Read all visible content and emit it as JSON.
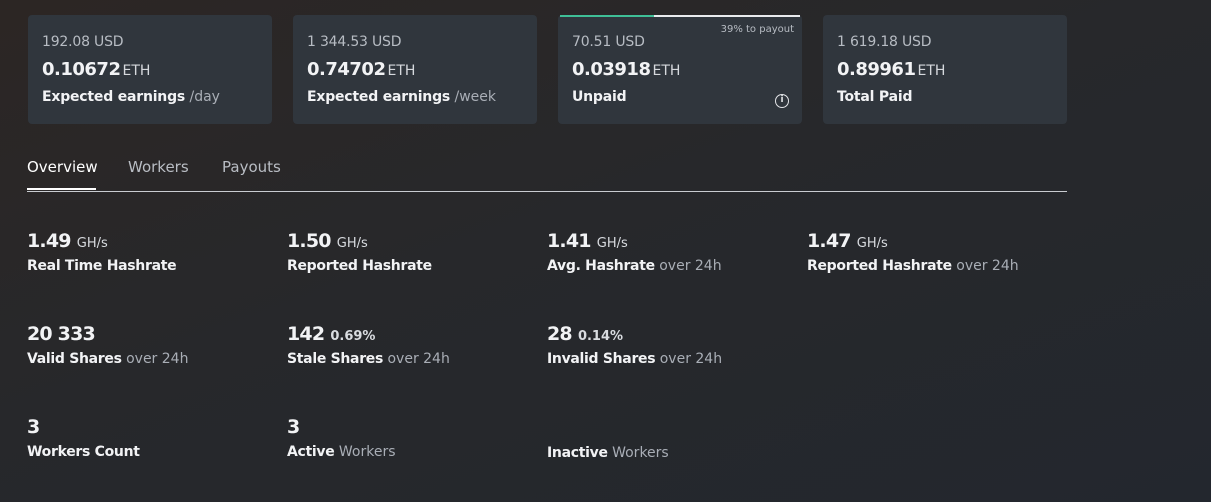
{
  "cards": [
    {
      "usd": "192.08 USD",
      "eth": "0.10672",
      "unit": "ETH",
      "label": "Expected earnings",
      "sub": "/day"
    },
    {
      "usd": "1 344.53 USD",
      "eth": "0.74702",
      "unit": "ETH",
      "label": "Expected earnings",
      "sub": "/week"
    },
    {
      "usd": "70.51 USD",
      "eth": "0.03918",
      "unit": "ETH",
      "label": "Unpaid",
      "payout_note": "39% to payout",
      "payout_progress": 0.39
    },
    {
      "usd": "1 619.18 USD",
      "eth": "0.89961",
      "unit": "ETH",
      "label": "Total Paid"
    }
  ],
  "tabs": [
    {
      "label": "Overview",
      "active": true
    },
    {
      "label": "Workers"
    },
    {
      "label": "Payouts"
    }
  ],
  "stats": {
    "realtime": {
      "value": "1.49",
      "unit": "GH/s",
      "label": "Real Time Hashrate"
    },
    "reported": {
      "value": "1.50",
      "unit": "GH/s",
      "label": "Reported Hashrate"
    },
    "avg": {
      "value": "1.41",
      "unit": "GH/s",
      "label": "Avg. Hashrate",
      "sub": "over 24h"
    },
    "reported24": {
      "value": "1.47",
      "unit": "GH/s",
      "label": "Reported Hashrate",
      "sub": "over 24h"
    },
    "valid": {
      "value": "20 333",
      "label": "Valid Shares",
      "sub": "over 24h"
    },
    "stale": {
      "value": "142",
      "pct": "0.69%",
      "label": "Stale Shares",
      "sub": "over 24h"
    },
    "invalid": {
      "value": "28",
      "pct": "0.14%",
      "label": "Invalid Shares",
      "sub": "over 24h"
    },
    "workers_count": {
      "value": "3",
      "label": "Workers Count"
    },
    "active": {
      "value": "3",
      "label": "Active",
      "sub": "Workers"
    },
    "inactive": {
      "value": "",
      "label": "Inactive",
      "sub": "Workers"
    }
  },
  "colors": {
    "progress": "#3fbf97",
    "card_bg": "#30363d"
  },
  "icons": {
    "unpaid_info": "info-icon"
  }
}
